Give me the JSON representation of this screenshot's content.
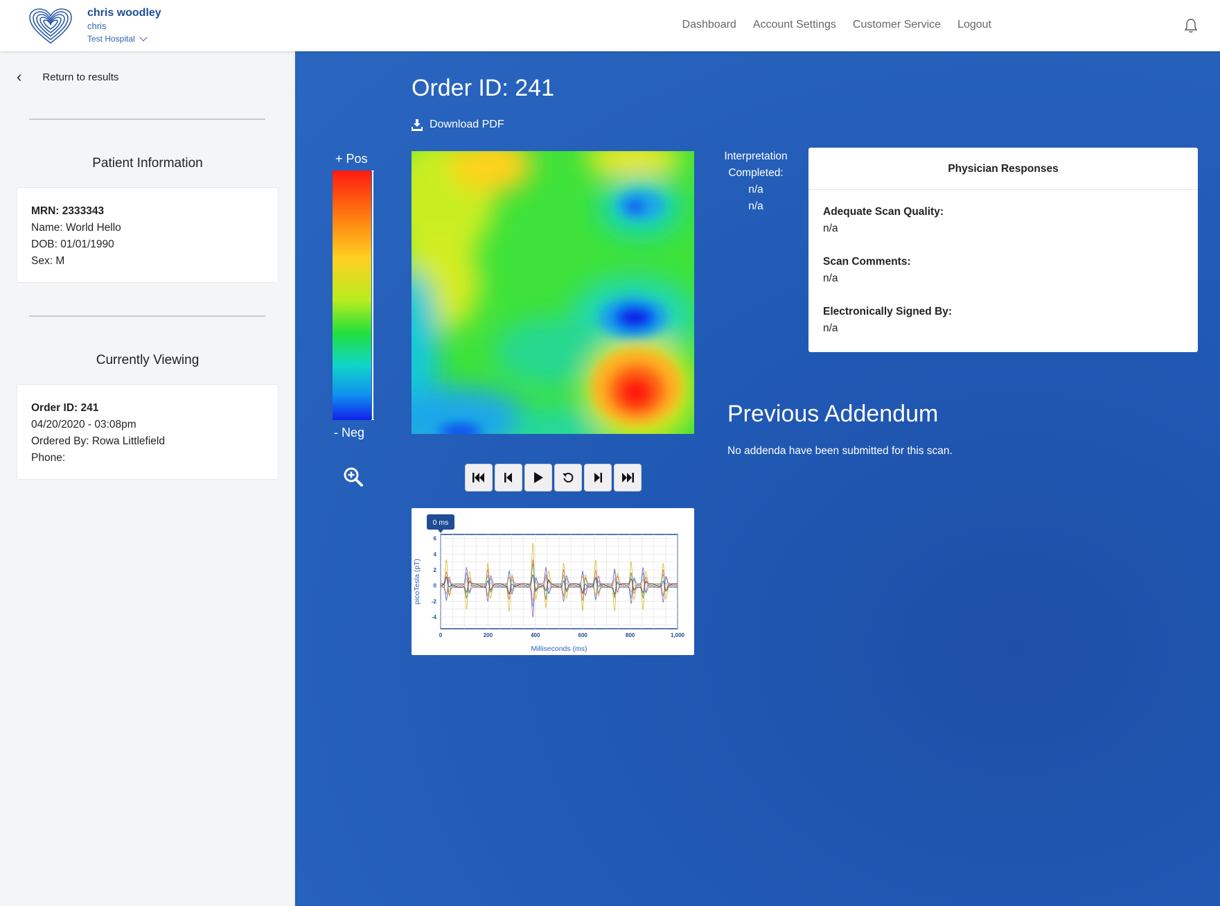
{
  "header": {
    "user_name": "chris woodley",
    "user_sub": "chris",
    "hospital": "Test Hospital",
    "nav": [
      "Dashboard",
      "Account Settings",
      "Customer Service",
      "Logout"
    ]
  },
  "sidebar": {
    "return_label": "Return to results",
    "patient_title": "Patient Information",
    "patient": {
      "mrn": "MRN: 2333343",
      "name": "Name: World Hello",
      "dob": "DOB: 01/01/1990",
      "sex": "Sex: M"
    },
    "viewing_title": "Currently Viewing",
    "viewing": {
      "order": "Order ID: 241",
      "datetime": "04/20/2020 - 03:08pm",
      "ordered_by": "Ordered By: Rowa Littlefield",
      "phone": "Phone:"
    }
  },
  "main": {
    "order_title": "Order ID: 241",
    "download_label": "Download PDF",
    "scale_pos": "+ Pos",
    "scale_neg": "- Neg",
    "interpretation": [
      "Interpretation",
      "Completed:",
      "n/a",
      "n/a"
    ],
    "physician": {
      "title": "Physician Responses",
      "items": [
        {
          "q": "Adequate Scan Quality:",
          "a": "n/a"
        },
        {
          "q": "Scan Comments:",
          "a": "n/a"
        },
        {
          "q": "Electronically Signed By:",
          "a": "n/a"
        }
      ]
    },
    "addendum_title": "Previous Addendum",
    "addendum_text": "No addenda have been submitted for this scan."
  },
  "colors": {
    "brand_blue": "#1f4d96",
    "main_bg": "#2059b4",
    "cursor_badge": "#1f4d96"
  },
  "chart_data": {
    "type": "line",
    "title": "",
    "xlabel": "Milliseconds (ms)",
    "ylabel": "picoTesla (pT)",
    "xlim": [
      0,
      1000
    ],
    "ylim": [
      -5.5,
      6.5
    ],
    "x_ticks": [
      "0",
      "200",
      "400",
      "600",
      "800",
      "1,000"
    ],
    "y_ticks": [
      "6",
      "4",
      "2",
      "0",
      "-2",
      "-4"
    ],
    "cursor_label": "0 ms",
    "cursor_x": 0,
    "grid": true,
    "beat_times_ms": [
      25,
      110,
      200,
      290,
      390,
      445,
      520,
      600,
      655,
      735,
      805,
      855,
      940
    ],
    "series_note_colors": [
      "#c9b400",
      "#7a3fa0",
      "#e34a4a",
      "#3b8ad6",
      "#45a86b",
      "#f08a3c",
      "#222b7a"
    ]
  }
}
